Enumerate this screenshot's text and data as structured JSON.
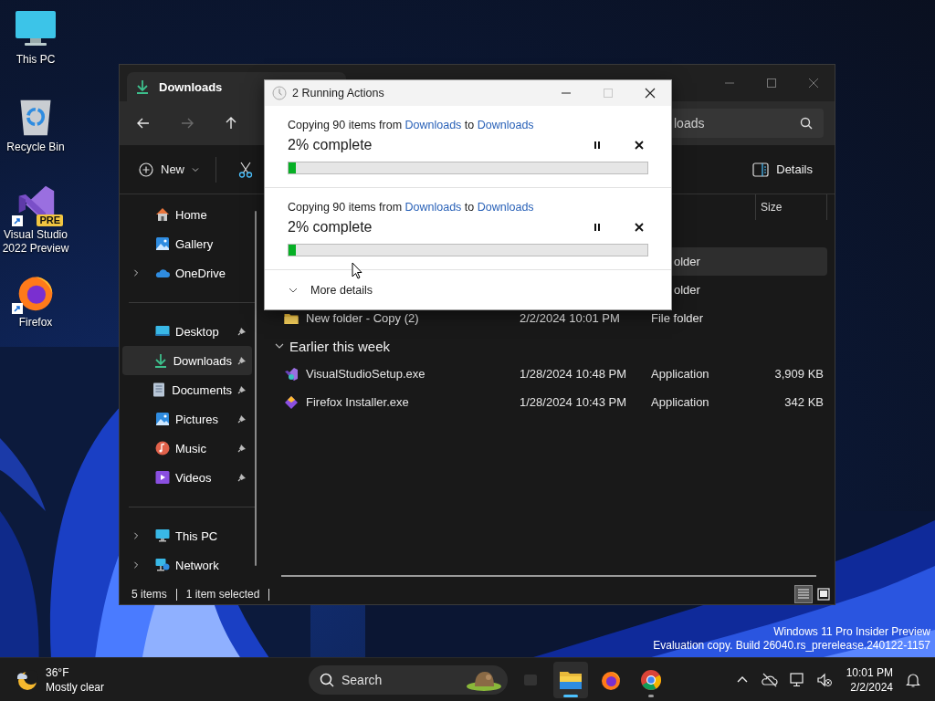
{
  "desktop": {
    "icons": [
      {
        "label": "This PC",
        "kind": "pc",
        "shortcut": false
      },
      {
        "label": "Recycle Bin",
        "kind": "bin",
        "shortcut": false
      },
      {
        "label": "Visual Studio 2022 Preview",
        "kind": "vs",
        "shortcut": true,
        "badge": "PRE"
      },
      {
        "label": "Firefox",
        "kind": "firefox",
        "shortcut": true
      }
    ],
    "build_notice": [
      "Windows 11 Pro Insider Preview",
      "Evaluation copy. Build 26040.rs_prerelease.240122-1157"
    ]
  },
  "explorer": {
    "tab": "Downloads",
    "nav_buttons": [
      {
        "kind": "back",
        "disabled": false
      },
      {
        "kind": "forward",
        "disabled": true
      },
      {
        "kind": "up",
        "disabled": false
      }
    ],
    "search": {
      "placeholder": "loads"
    },
    "commands": {
      "new": "New",
      "details": "Details"
    },
    "sidebar": [
      {
        "items": [
          {
            "label": "Home",
            "kind": "home",
            "expandable": false,
            "pinned": false,
            "selected": false
          },
          {
            "label": "Gallery",
            "kind": "gallery",
            "expandable": false,
            "pinned": false,
            "selected": false
          },
          {
            "label": "OneDrive",
            "kind": "onedrive",
            "expandable": true,
            "pinned": false,
            "selected": false
          }
        ]
      },
      {
        "items": [
          {
            "label": "Desktop",
            "kind": "desktop",
            "expandable": false,
            "pinned": true,
            "selected": false
          },
          {
            "label": "Downloads",
            "kind": "downloads",
            "expandable": false,
            "pinned": true,
            "selected": true
          },
          {
            "label": "Documents",
            "kind": "documents",
            "expandable": false,
            "pinned": true,
            "selected": false
          },
          {
            "label": "Pictures",
            "kind": "pictures",
            "expandable": false,
            "pinned": true,
            "selected": false
          },
          {
            "label": "Music",
            "kind": "music",
            "expandable": false,
            "pinned": true,
            "selected": false
          },
          {
            "label": "Videos",
            "kind": "videos",
            "expandable": false,
            "pinned": true,
            "selected": false
          }
        ]
      },
      {
        "items": [
          {
            "label": "This PC",
            "kind": "pc",
            "expandable": true,
            "pinned": false,
            "selected": false
          },
          {
            "label": "Network",
            "kind": "network",
            "expandable": true,
            "pinned": false,
            "selected": false
          }
        ]
      }
    ],
    "columns": [
      {
        "label": "Size"
      }
    ],
    "groups": [
      {
        "rows": [
          {
            "type": "older",
            "kind": "partial",
            "selected": true
          },
          {
            "type": "older",
            "kind": "partial",
            "selected": false
          },
          {
            "name": "New folder - Copy (2)",
            "date": "2/2/2024 10:01 PM",
            "type": "File folder",
            "kind": "folder",
            "selected": false
          }
        ]
      },
      {
        "title": "Earlier this week",
        "expanded": true,
        "rows": [
          {
            "name": "VisualStudioSetup.exe",
            "date": "1/28/2024 10:48 PM",
            "type": "Application",
            "size": "3,909 KB",
            "kind": "vs",
            "selected": false
          },
          {
            "name": "Firefox Installer.exe",
            "date": "1/28/2024 10:43 PM",
            "type": "Application",
            "size": "342 KB",
            "kind": "firefox",
            "selected": false
          }
        ]
      }
    ],
    "status": {
      "count": "5 items",
      "selection": "1 item selected"
    },
    "view": {
      "details_selected": true
    }
  },
  "dialog": {
    "title": "2 Running Actions",
    "max_disabled": true,
    "operations": [
      {
        "text_before": "Copying 90 items from",
        "source": "Downloads",
        "text_between": "to",
        "destination": "Downloads",
        "status": "2% complete",
        "level": 0.02
      },
      {
        "text_before": "Copying 90 items from",
        "source": "Downloads",
        "text_between": "to",
        "destination": "Downloads",
        "status": "2% complete",
        "level": 0.02
      }
    ],
    "more_details": {
      "label": "More details",
      "expanded": false
    }
  },
  "taskbar": {
    "weather": {
      "temperature": "36°F",
      "condition": "Mostly clear"
    },
    "search": {
      "placeholder": "Search"
    },
    "apps": [
      {
        "kind": "task-view",
        "active": false,
        "running": false
      },
      {
        "kind": "explorer",
        "active": true,
        "running": true
      },
      {
        "kind": "firefox",
        "active": false,
        "running": false
      },
      {
        "kind": "chrome",
        "active": false,
        "running": true
      }
    ],
    "clock": {
      "time": "10:01 PM",
      "date": "2/2/2024"
    }
  }
}
